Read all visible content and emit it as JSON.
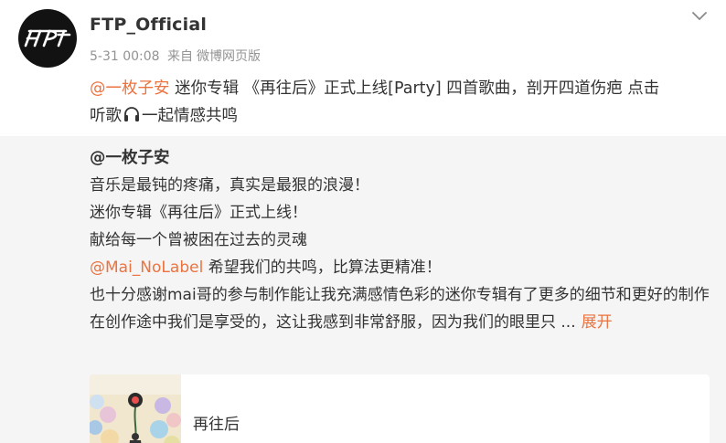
{
  "post": {
    "username": "FTP_Official",
    "timestamp": "5-31 00:08",
    "source_prefix": "来自",
    "source": "微博网页版",
    "text": {
      "mention": "@一枚子安",
      "line1_rest": " 迷你专辑 《再往后》正式上线[Party] 四首歌曲，剖开四道伤疤 点击",
      "line2_prefix": "听歌",
      "line2_suffix": "一起情感共鸣"
    }
  },
  "repost": {
    "author": "@一枚子安",
    "lines": [
      "音乐是最钝的疼痛，真实是最狠的浪漫！",
      "迷你专辑《再往后》正式上线！",
      "献给每一个曾被困在过去的灵魂"
    ],
    "mention": "@Mai_NoLabel",
    "mention_rest": " 希望我们的共鸣，比算法更精准！",
    "long_line": "也十分感谢mai哥的参与制作能让我充满感情色彩的迷你专辑有了更多的细节和更好的制作",
    "last_line": "在创作途中我们是享受的，这让我感到非常舒服，因为我们的眼里只 ...",
    "expand_label": "展开"
  },
  "music_card": {
    "title": "再往后"
  },
  "icons": {
    "avatar_logo": "ftp-logo",
    "menu": "chevron-down-icon",
    "inline": "headphone-icon"
  },
  "colors": {
    "mention": "#eb7340",
    "meta": "#939393",
    "repost_bg": "#f5f5f5"
  }
}
